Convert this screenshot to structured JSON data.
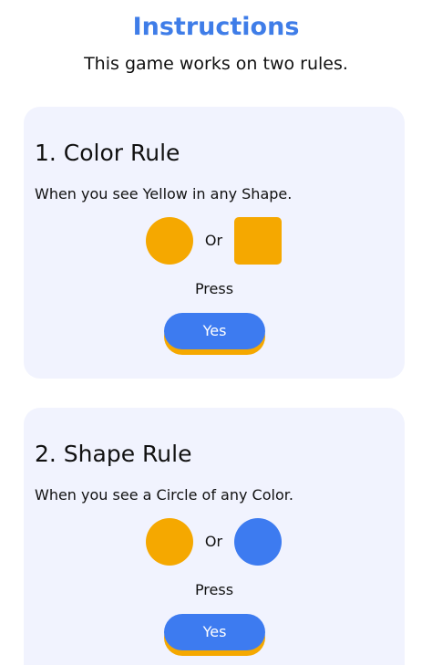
{
  "header": {
    "title": "Instructions",
    "subtitle": "This game works on two rules."
  },
  "colors": {
    "accent_blue": "#3f7de8",
    "yellow": "#f5a800",
    "button_blue": "#3d7bf0",
    "button_shadow": "#f5a800",
    "card_bg": "#f1f3fe"
  },
  "rules": [
    {
      "title": "1. Color Rule",
      "description": "When you see Yellow in any Shape.",
      "left_shape": "yellow-circle-icon",
      "or_label": "Or",
      "right_shape": "yellow-square-icon",
      "press_label": "Press",
      "button_label": "Yes"
    },
    {
      "title": "2. Shape Rule",
      "description": "When you see a Circle of any Color.",
      "left_shape": "yellow-circle-icon",
      "or_label": "Or",
      "right_shape": "blue-circle-icon",
      "press_label": "Press",
      "button_label": "Yes"
    }
  ]
}
